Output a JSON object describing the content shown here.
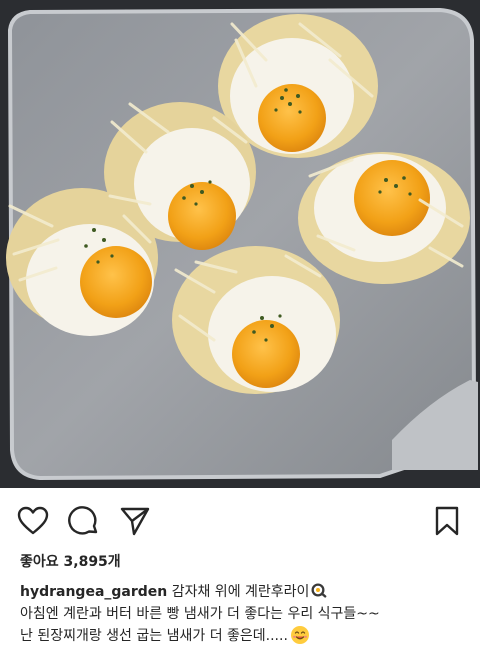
{
  "post": {
    "image_alt": "",
    "likes_text": "좋아요 3,895개",
    "caption": {
      "username": "hydrangea_garden",
      "text_line1": "감자채 위에 계란후라이",
      "line2": "아침엔 계란과 버터 바른 빵 냄새가 더 좋다는 우리 식구들~~",
      "line3": "난 된장찌개랑 생선 굽는 냄새가 더 좋은데.....",
      "emoji1": "frying-pan-egg",
      "emoji2": "smiling-face"
    }
  },
  "actions": {
    "like_icon": "heart-icon",
    "comment_icon": "comment-icon",
    "share_icon": "send-icon",
    "save_icon": "bookmark-icon"
  }
}
